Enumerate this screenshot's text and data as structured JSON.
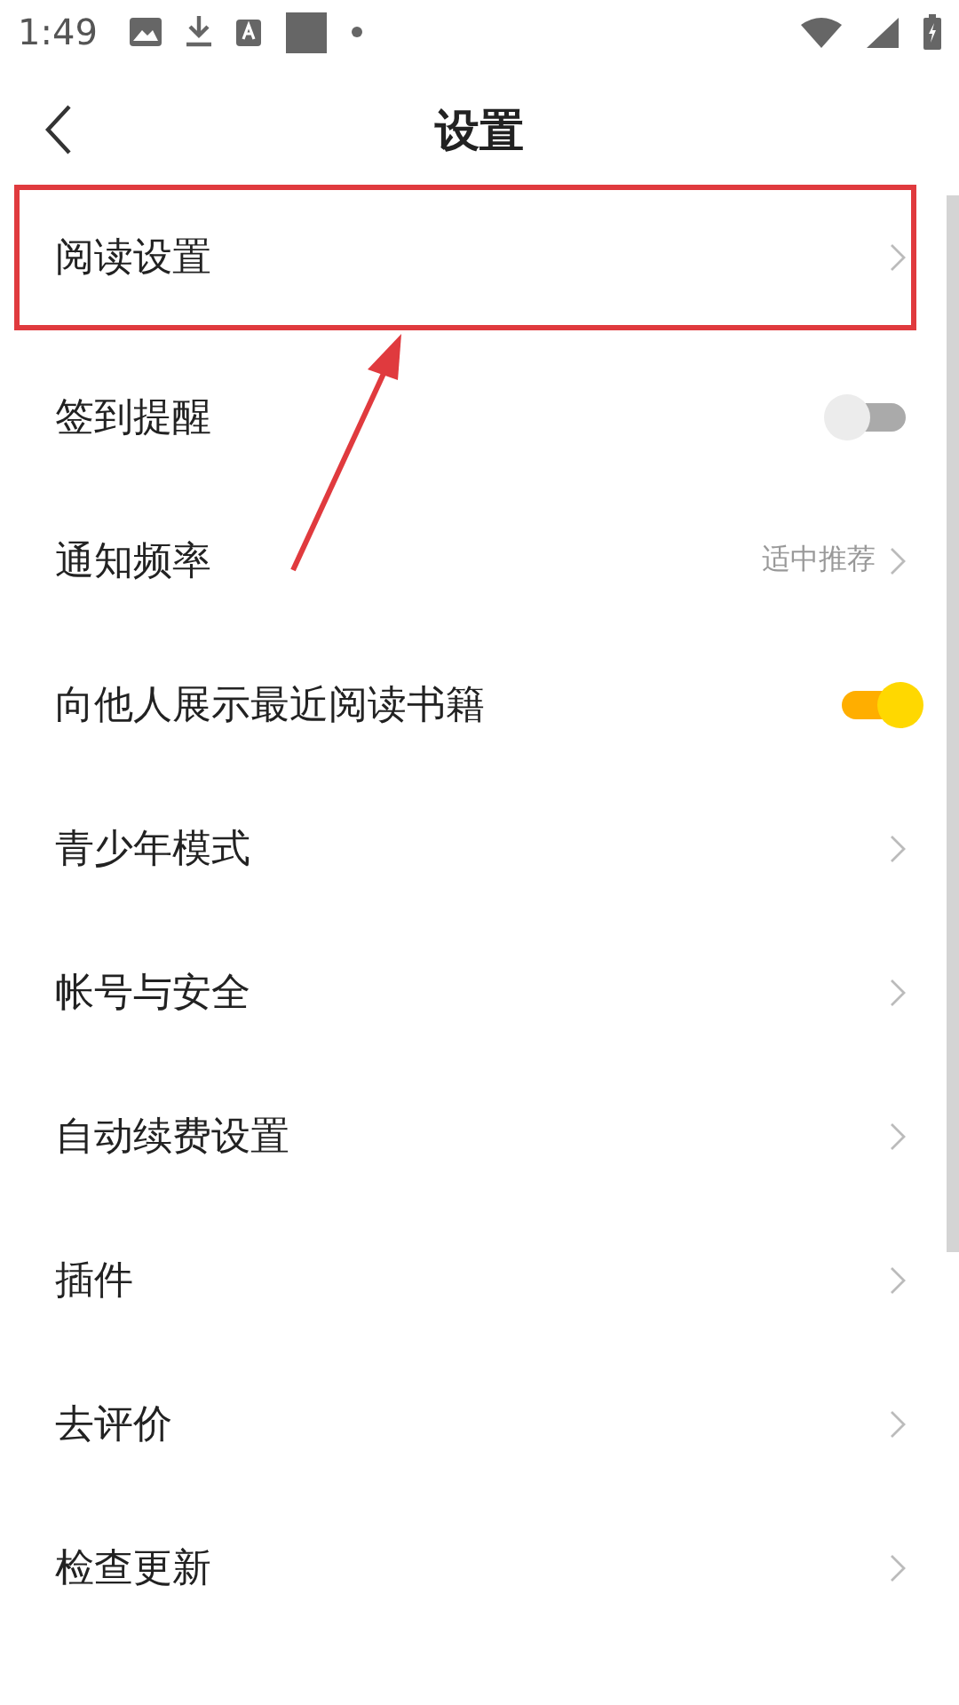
{
  "status_bar": {
    "time": "1:49"
  },
  "header": {
    "title": "设置"
  },
  "rows": [
    {
      "kind": "link",
      "label": "阅读设置",
      "highlighted": true
    },
    {
      "kind": "toggle",
      "label": "签到提醒",
      "on": false,
      "highlighted": false
    },
    {
      "kind": "link",
      "label": "通知频率",
      "value": "适中推荐",
      "highlighted": false
    },
    {
      "kind": "toggle",
      "label": "向他人展示最近阅读书籍",
      "on": true,
      "highlighted": false
    },
    {
      "kind": "link",
      "label": "青少年模式",
      "highlighted": false
    },
    {
      "kind": "link",
      "label": "帐号与安全",
      "highlighted": false
    },
    {
      "kind": "link",
      "label": "自动续费设置",
      "highlighted": false
    },
    {
      "kind": "link",
      "label": "插件",
      "highlighted": false
    },
    {
      "kind": "link",
      "label": "去评价",
      "highlighted": false
    },
    {
      "kind": "link",
      "label": "检查更新",
      "highlighted": false
    }
  ],
  "pointer_arrow": true
}
